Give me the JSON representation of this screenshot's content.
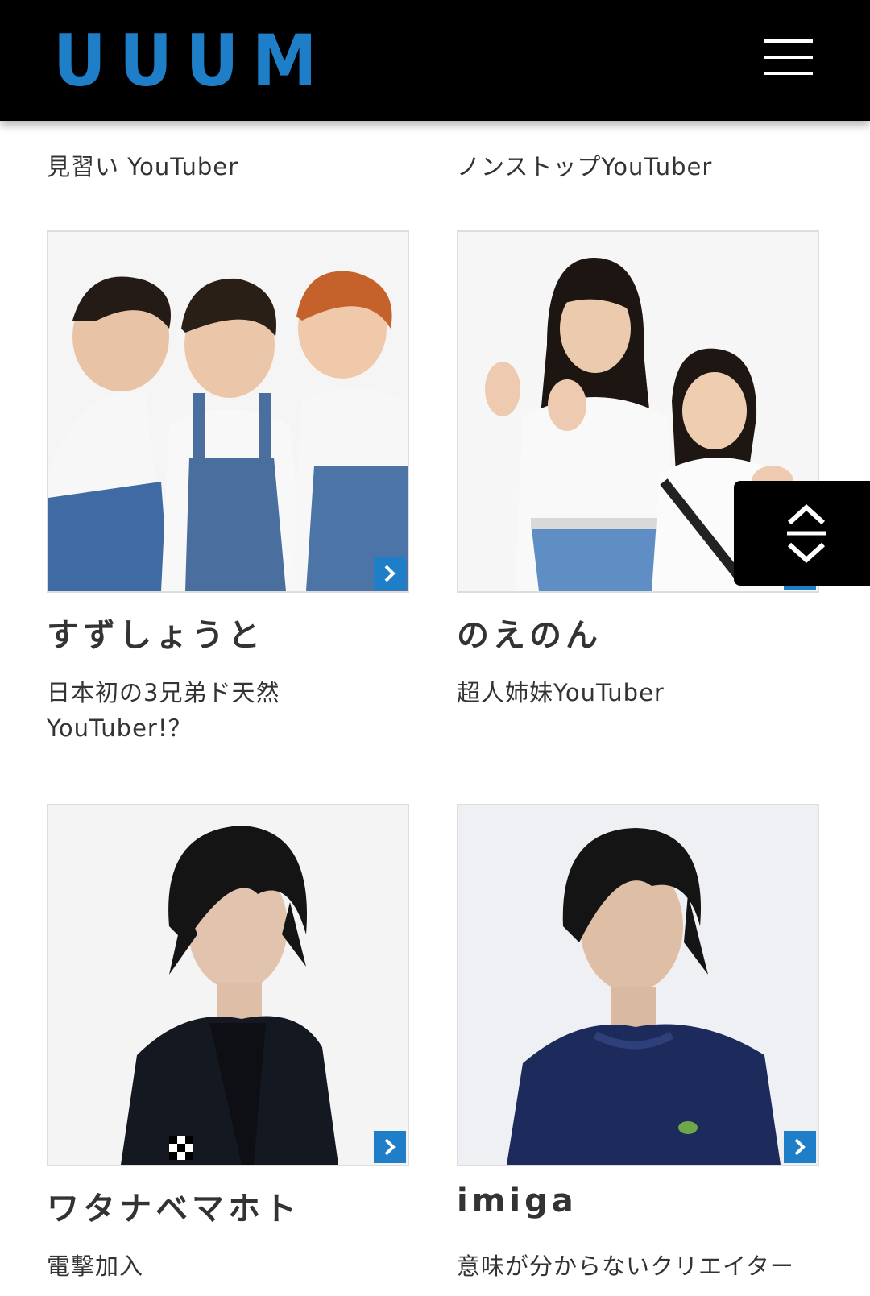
{
  "header": {
    "logo_text": "UUUM",
    "logo_color": "#1e7fc8",
    "menu_icon": "hamburger-menu-icon"
  },
  "top_row": {
    "left_description": "見習い YouTuber",
    "right_description": "ノンストップYouTuber"
  },
  "creators": [
    {
      "name": "すずしょうと",
      "description": "日本初の3兄弟ド天然YouTuber!？"
    },
    {
      "name": "のえのん",
      "description": "超人姉妹YouTuber"
    },
    {
      "name": "ワタナベマホト",
      "description": "電撃加入"
    },
    {
      "name": "imiga",
      "description": "意味が分からないクリエイター"
    }
  ],
  "scroll_button": {
    "icon": "scroll-up-down-icon"
  },
  "colors": {
    "header_bg": "#000000",
    "accent": "#1e7fc8",
    "text": "#333333"
  }
}
